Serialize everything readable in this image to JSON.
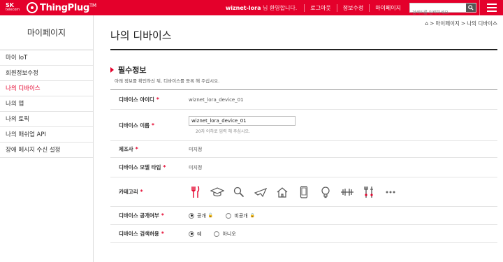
{
  "header": {
    "brand_sub": "telecom",
    "brand_sk": "SK",
    "brand_name": "ThingPlug",
    "brand_tm": "TM",
    "user": "wiznet-lora",
    "greeting": "님 환영합니다.",
    "logout": "로그아웃",
    "edit_info": "정보수정",
    "my_page": "마이페이지",
    "search_placeholder": "검색어를 입력하세요."
  },
  "sidebar": {
    "title": "마이페이지",
    "items": [
      {
        "label": "마이 IoT"
      },
      {
        "label": "회원정보수정"
      },
      {
        "label": "나의 디바이스"
      },
      {
        "label": "나의 앱"
      },
      {
        "label": "나의 토픽"
      },
      {
        "label": "나의 매쉬업 API"
      },
      {
        "label": "장애 메시지 수신 설정"
      }
    ],
    "active_index": 2
  },
  "breadcrumb": {
    "home": "⌂",
    "sep": ">",
    "level1": "마이페이지",
    "level2": "나의 디바이스"
  },
  "page": {
    "title": "나의 디바이스",
    "section_title": "필수정보",
    "section_desc": "아래 정보를 확인하신 뒤, 디바이스를 등록 해 주십시오."
  },
  "form": {
    "required_mark": "*",
    "device_id": {
      "label": "디바이스 아이디",
      "value": "wiznet_lora_device_01"
    },
    "device_name": {
      "label": "디바이스 이름",
      "value": "wiznet_lora_device_01",
      "hint": "20자 이하로 입력 해 주십시오."
    },
    "maker": {
      "label": "제조사",
      "value": "미지정"
    },
    "model": {
      "label": "디바이스 모델 타입",
      "value": "미지정"
    },
    "category": {
      "label": "카테고리",
      "icons": [
        "dining-icon",
        "graduation-cap-icon",
        "magnifier-icon",
        "airplane-icon",
        "home-icon",
        "smartphone-icon",
        "lightbulb-icon",
        "dumbbell-icon",
        "tools-icon",
        "more-icon"
      ]
    },
    "public": {
      "label": "디바이스 공개여부",
      "opt_public": "공개",
      "opt_private": "비공개"
    },
    "search": {
      "label": "디바이스 검색허용",
      "opt_yes": "예",
      "opt_no": "아니오"
    }
  },
  "colors": {
    "brand": "#e4002b"
  }
}
